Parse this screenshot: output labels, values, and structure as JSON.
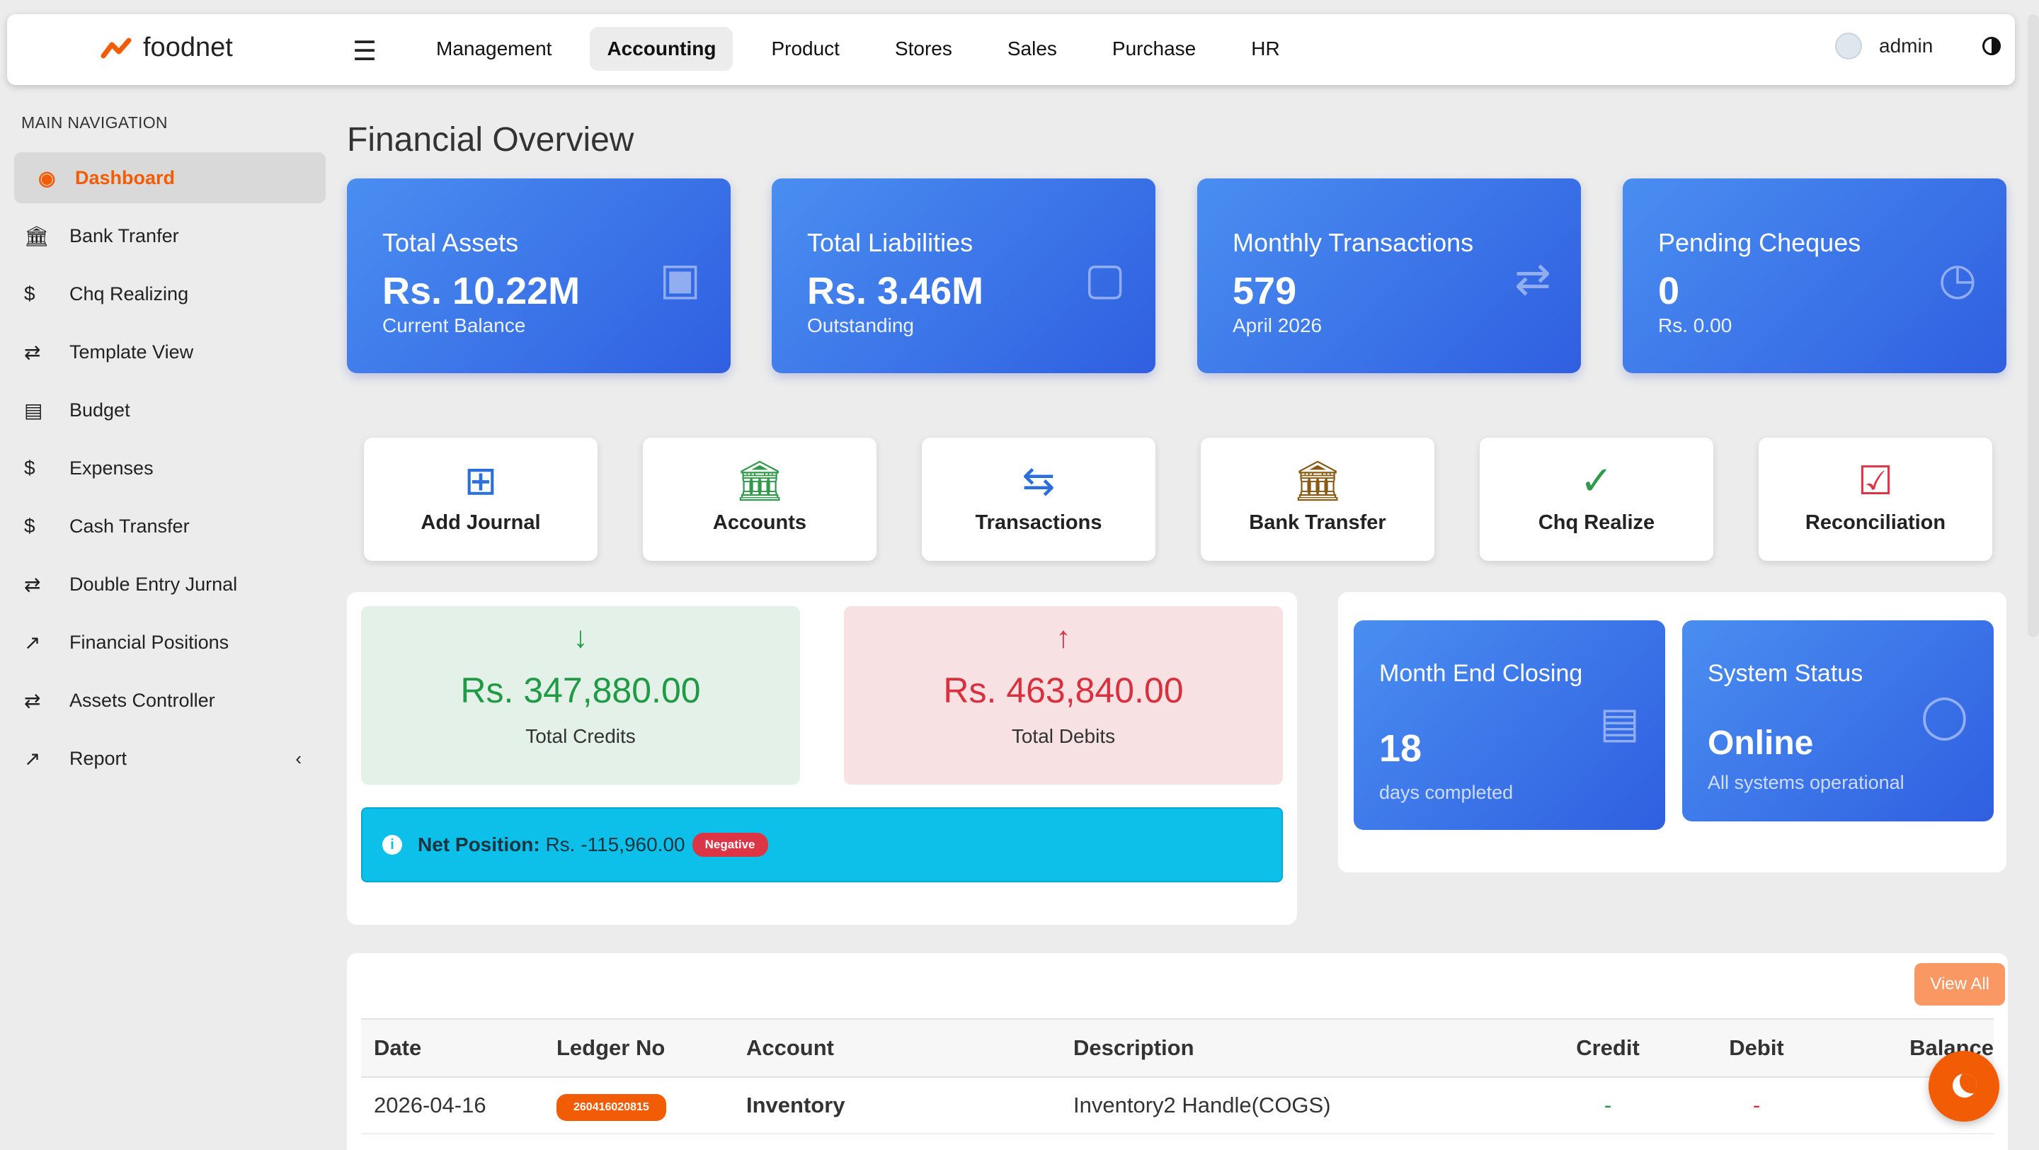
{
  "app": {
    "logo_text": "foodnet",
    "brand_color": "#f25c05"
  },
  "topnav": {
    "items": [
      "Management",
      "Accounting",
      "Product",
      "Stores",
      "Sales",
      "Purchase",
      "HR"
    ],
    "active": "Accounting",
    "user": "admin"
  },
  "sidebar": {
    "title": "MAIN NAVIGATION",
    "items": [
      {
        "label": "Dashboard",
        "icon": "palette-icon"
      },
      {
        "label": "Bank Tranfer",
        "icon": "bank-icon"
      },
      {
        "label": "Chq Realizing",
        "icon": "dollar-icon"
      },
      {
        "label": "Template View",
        "icon": "exchange-icon"
      },
      {
        "label": "Budget",
        "icon": "card-icon"
      },
      {
        "label": "Expenses",
        "icon": "dollar-icon"
      },
      {
        "label": "Cash Transfer",
        "icon": "dollar-icon"
      },
      {
        "label": "Double Entry Jurnal",
        "icon": "exchange-icon"
      },
      {
        "label": "Financial Positions",
        "icon": "chart-icon"
      },
      {
        "label": "Assets Controller",
        "icon": "exchange-icon"
      },
      {
        "label": "Report",
        "icon": "chart-icon"
      }
    ]
  },
  "page": {
    "title": "Financial Overview"
  },
  "stats": [
    {
      "label": "Total Assets",
      "value": "Rs. 10.22M",
      "sub": "Current Balance",
      "icon": "money-icon"
    },
    {
      "label": "Total Liabilities",
      "value": "Rs. 3.46M",
      "sub": "Outstanding",
      "icon": "wallet-icon"
    },
    {
      "label": "Monthly Transactions",
      "value": "579",
      "sub": "April 2026",
      "icon": "exchange-icon"
    },
    {
      "label": "Pending Cheques",
      "value": "0",
      "sub": "Rs. 0.00",
      "icon": "clock-icon"
    }
  ],
  "quick_actions": [
    {
      "label": "Add Journal",
      "icon": "journal-plus-icon"
    },
    {
      "label": "Accounts",
      "icon": "bank-icon"
    },
    {
      "label": "Transactions",
      "icon": "exchange-icon"
    },
    {
      "label": "Bank Transfer",
      "icon": "bank-icon"
    },
    {
      "label": "Chq Realize",
      "icon": "check-circle-icon"
    },
    {
      "label": "Reconciliation",
      "icon": "clipboard-check-icon"
    }
  ],
  "totals": {
    "credits_value": "Rs. 347,880.00",
    "credits_label": "Total Credits",
    "debits_value": "Rs. 463,840.00",
    "debits_label": "Total Debits",
    "net_label": "Net Position:",
    "net_value": "Rs. -115,960.00",
    "net_badge": "Negative"
  },
  "month_end": {
    "label": "Month End Closing",
    "value": "18",
    "sub": "days completed"
  },
  "system_status": {
    "label": "System Status",
    "value": "Online",
    "sub": "All systems operational"
  },
  "table": {
    "view_all": "View All",
    "headers": [
      "Date",
      "Ledger No",
      "Account",
      "Description",
      "Credit",
      "Debit",
      "Balance"
    ],
    "rows": [
      {
        "date": "2026-04-16",
        "ledger": "260416020815",
        "account": "Inventory",
        "description": "Inventory2 Handle(COGS)",
        "credit": "-",
        "debit": "-",
        "balance": ""
      }
    ]
  }
}
